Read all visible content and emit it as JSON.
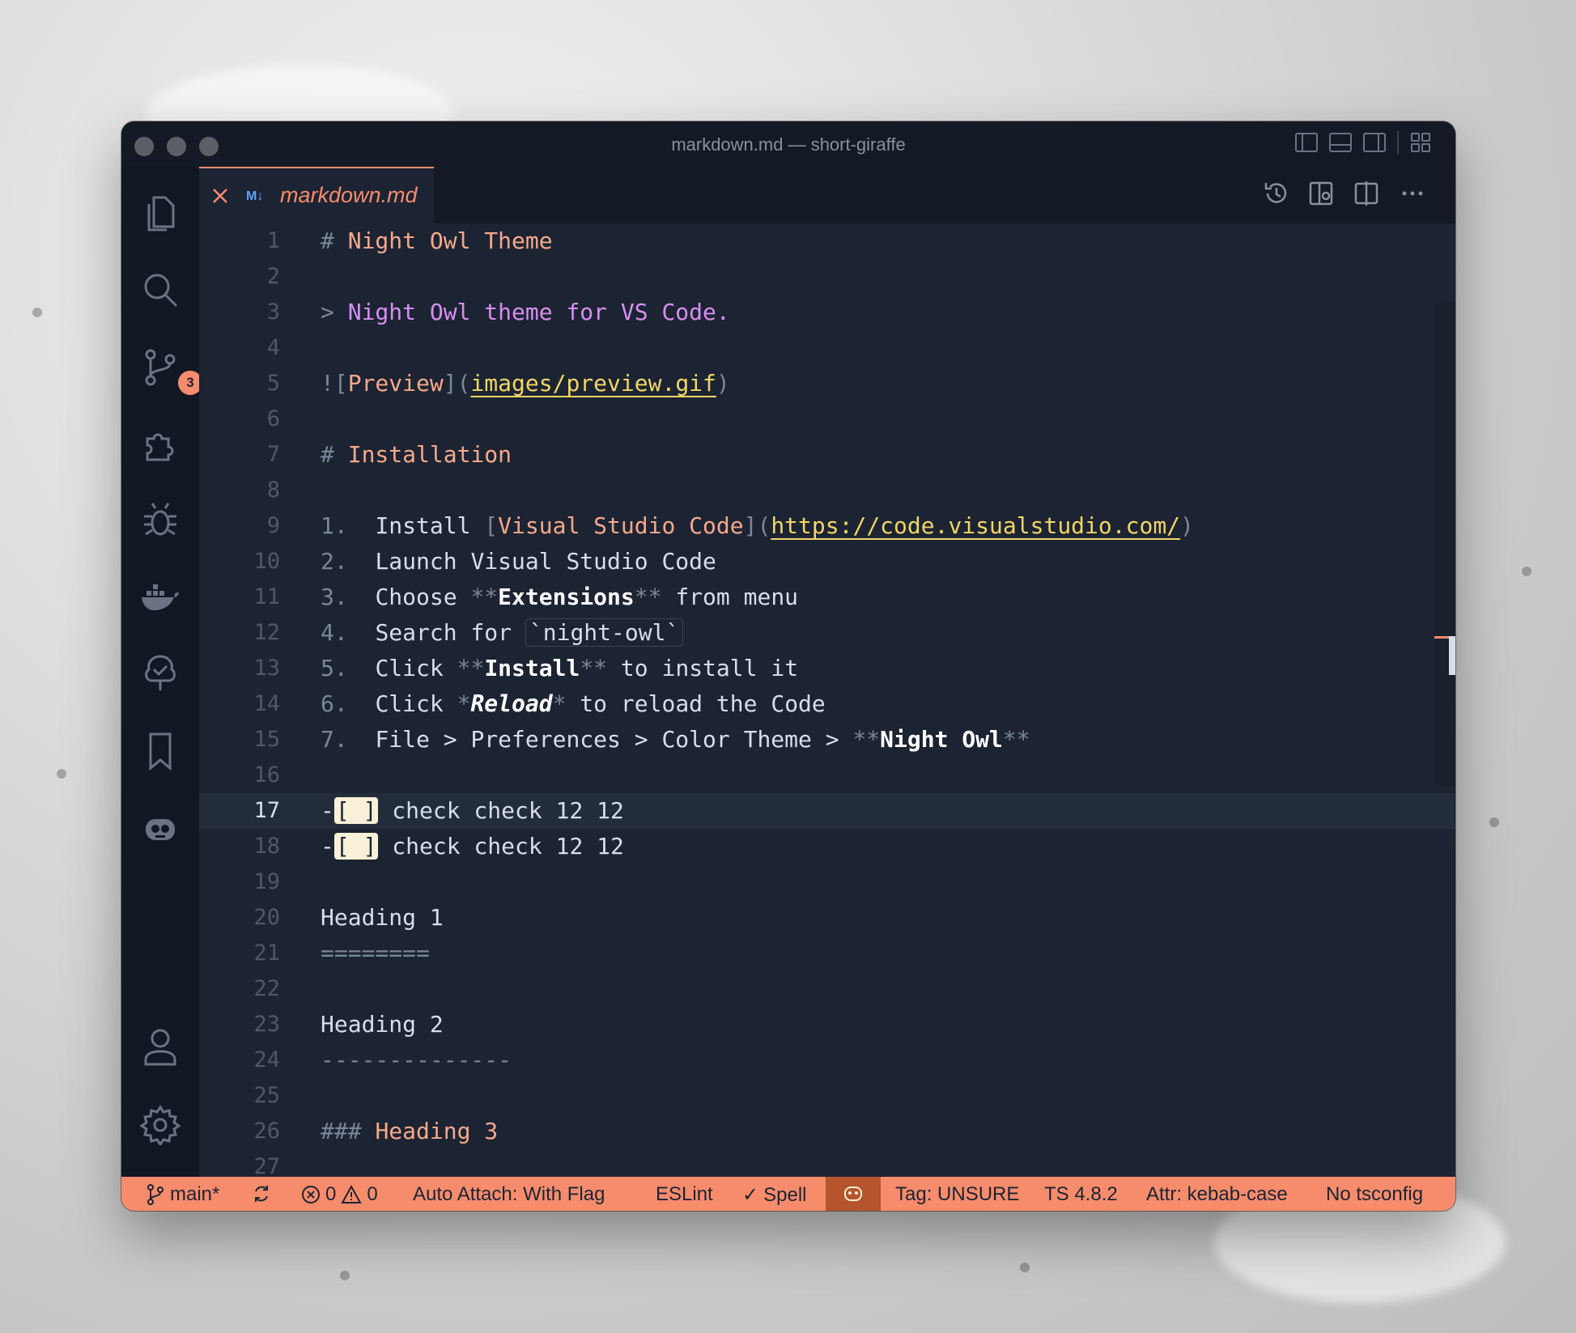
{
  "window": {
    "title": "markdown.md — short-giraffe"
  },
  "activity": {
    "scm_badge": "3"
  },
  "tab": {
    "icon_text": "M↓",
    "label": "markdown.md"
  },
  "editor": {
    "lines": [
      {
        "n": "1"
      },
      {
        "n": "2"
      },
      {
        "n": "3"
      },
      {
        "n": "4"
      },
      {
        "n": "5"
      },
      {
        "n": "6"
      },
      {
        "n": "7"
      },
      {
        "n": "8"
      },
      {
        "n": "9"
      },
      {
        "n": "10"
      },
      {
        "n": "11"
      },
      {
        "n": "12"
      },
      {
        "n": "13"
      },
      {
        "n": "14"
      },
      {
        "n": "15"
      },
      {
        "n": "16"
      },
      {
        "n": "17"
      },
      {
        "n": "18"
      },
      {
        "n": "19"
      },
      {
        "n": "20"
      },
      {
        "n": "21"
      },
      {
        "n": "22"
      },
      {
        "n": "23"
      },
      {
        "n": "24"
      },
      {
        "n": "25"
      },
      {
        "n": "26"
      },
      {
        "n": "27"
      }
    ],
    "l1": {
      "hash": "#",
      "text": "Night Owl Theme"
    },
    "l3": {
      "gt": ">",
      "text": "Night Owl theme for VS Code."
    },
    "l5": {
      "open": "![",
      "alt": "Preview",
      "mid": "](",
      "url": "images/preview.gif",
      "close": ")"
    },
    "l7": {
      "hash": "#",
      "text": "Installation"
    },
    "l9": {
      "num": "1.",
      "pre": "Install ",
      "lb": "[",
      "ltext": "Visual Studio Code",
      "mid": "](",
      "url": "https://code.visualstudio.com/",
      "close": ")"
    },
    "l10": {
      "num": "2.",
      "text": "Launch Visual Studio Code"
    },
    "l11": {
      "num": "3.",
      "pre": "Choose ",
      "m1": "**",
      "bold": "Extensions",
      "m2": "**",
      "post": " from menu"
    },
    "l12": {
      "num": "4.",
      "pre": "Search for ",
      "code": "`night-owl`"
    },
    "l13": {
      "num": "5.",
      "pre": "Click ",
      "m1": "**",
      "bold": "Install",
      "m2": "**",
      "post": " to install it"
    },
    "l14": {
      "num": "6.",
      "pre": "Click ",
      "m1": "*",
      "ital": "Reload",
      "m2": "*",
      "post": " to reload the Code"
    },
    "l15": {
      "num": "7.",
      "pre": "File > Preferences > Color Theme > ",
      "m1": "**",
      "bold": "Night Owl",
      "m2": "**"
    },
    "l17": {
      "dash": "-",
      "box": "[ ]",
      "text": " check check 12 12"
    },
    "l18": {
      "dash": "-",
      "box": "[ ]",
      "text": " check check 12 12"
    },
    "l20": {
      "text": "Heading 1"
    },
    "l21": {
      "text": "========"
    },
    "l23": {
      "text": "Heading 2"
    },
    "l24": {
      "text": "--------------"
    },
    "l26": {
      "hash": "###",
      "text": "Heading 3"
    }
  },
  "status": {
    "branch": "main*",
    "errors": "0",
    "warnings": "0",
    "auto_attach": "Auto Attach: With Flag",
    "eslint": "ESLint",
    "spell": "Spell",
    "tag": "Tag: UNSURE",
    "ts": "TS 4.8.2",
    "attr": "Attr: kebab-case",
    "tsconfig": "No tsconfig"
  },
  "colors": {
    "accent": "#f78c6c",
    "background": "#1c2433",
    "heading": "#f7a88a",
    "link": "#f2d565",
    "quote": "#d88ef0"
  }
}
